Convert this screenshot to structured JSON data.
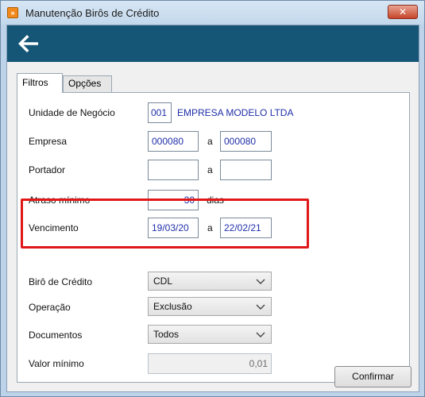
{
  "window": {
    "title": "Manutenção Birôs de Crédito",
    "app_icon_glyph": "»",
    "close_glyph": "✕"
  },
  "tabs": [
    {
      "label": "Filtros",
      "active": true
    },
    {
      "label": "Opções",
      "active": false
    }
  ],
  "form": {
    "unidade": {
      "label": "Unidade de Negócio",
      "code": "001",
      "name": "EMPRESA MODELO LTDA"
    },
    "empresa": {
      "label": "Empresa",
      "from": "000080",
      "separator": "a",
      "to": "000080"
    },
    "portador": {
      "label": "Portador",
      "from": "",
      "separator": "a",
      "to": ""
    },
    "atraso": {
      "label": "Atraso mínimo",
      "value": "30",
      "unit": "dias"
    },
    "vencimento": {
      "label": "Vencimento",
      "from": "19/03/20",
      "separator": "a",
      "to": "22/02/21"
    },
    "biro": {
      "label": "Birô de Crédito",
      "selected": "CDL"
    },
    "operacao": {
      "label": "Operação",
      "selected": "Exclusão"
    },
    "documentos": {
      "label": "Documentos",
      "selected": "Todos"
    },
    "valor_minimo": {
      "label": "Valor mínimo",
      "value": "0,01"
    }
  },
  "buttons": {
    "confirm_label": "Confirmar"
  },
  "colors": {
    "header_bar": "#155576",
    "highlight": "#e01818",
    "field_text": "#1f2fa8"
  },
  "icons": [
    "app-icon",
    "close-icon",
    "back-arrow-icon",
    "chevron-down-icon"
  ]
}
